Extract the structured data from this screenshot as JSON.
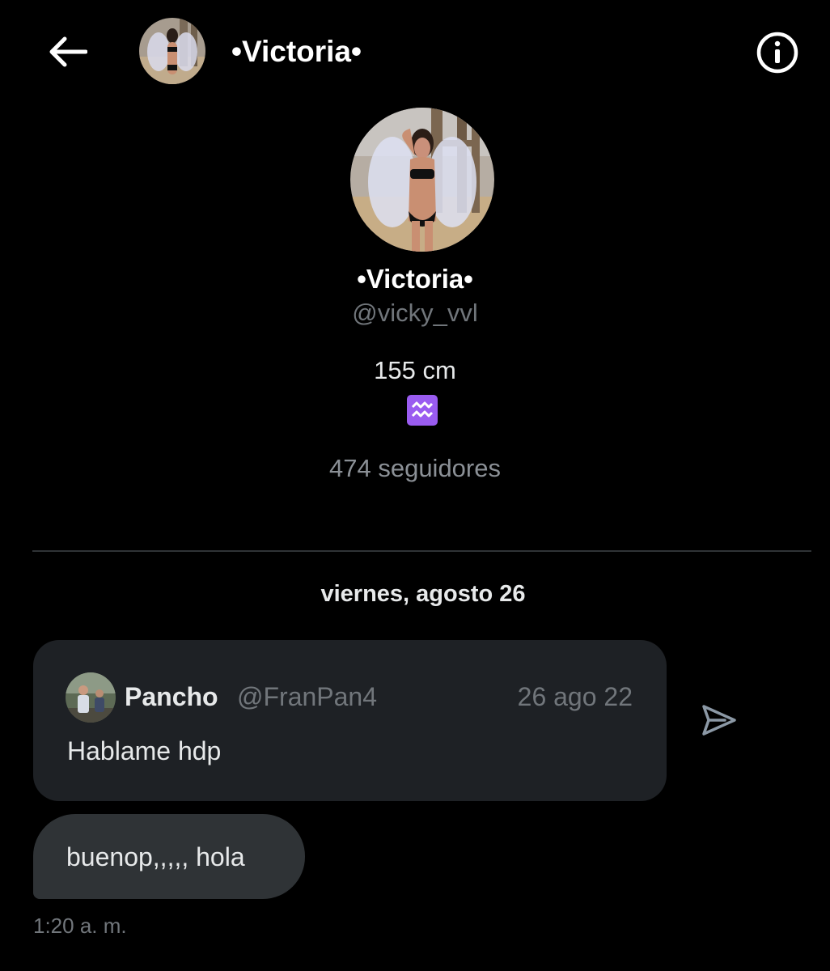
{
  "header": {
    "contact_name": "•Victoria•",
    "back_icon": "arrow-left-icon",
    "info_icon": "info-circle-icon"
  },
  "profile": {
    "name": "•Victoria•",
    "handle": "@vicky_vvl",
    "bio_text": "155 cm",
    "bio_emoji": "♒",
    "followers": "474 seguidores"
  },
  "conversation": {
    "date_separator": "viernes, agosto 26",
    "shared_tweet": {
      "author": "Pancho",
      "handle": "@FranPan4",
      "date": "26 ago 22",
      "text": "Hablame hdp"
    },
    "message": {
      "text": "buenop,,,,, hola",
      "time": "1:20 a. m."
    }
  },
  "colors": {
    "background": "#000000",
    "bubble_received": "#2f3336",
    "tweet_card": "#1e2125",
    "muted_text": "#71767b",
    "zodiac_purple": "#9a5cf0"
  }
}
